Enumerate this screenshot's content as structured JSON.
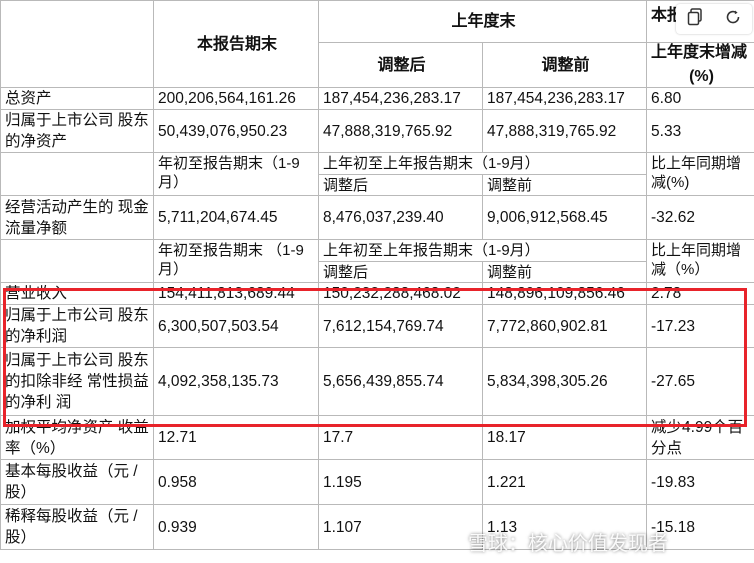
{
  "header": {
    "current_period_end": "本报告期末",
    "last_year_end": "上年度末",
    "adjusted_after": "调整后",
    "adjusted_before": "调整前",
    "change_top_partial": "本报",
    "change_label": "上年度末增减",
    "change_unit": "(%)"
  },
  "rows_top": [
    {
      "label": "总资产",
      "current": "200,206,564,161.26",
      "after": "187,454,236,283.17",
      "before": "187,454,236,283.17",
      "change": "6.80"
    },
    {
      "label": "归属于上市公司 股东的净资产",
      "current": "50,439,076,950.23",
      "after": "47,888,319,765.92",
      "before": "47,888,319,765.92",
      "change": "5.33"
    }
  ],
  "subheader1": {
    "current": "年初至报告期末（1-9 月）",
    "last_year": "上年初至上年报告期末（1-9月）",
    "after": "调整后",
    "before": "调整前",
    "change": "比上年同期增 减(%)"
  },
  "cashflow": {
    "label": "经营活动产生的 现金流量净额",
    "current": "5,711,204,674.45",
    "after": "8,476,037,239.40",
    "before": "9,006,912,568.45",
    "change": "-32.62"
  },
  "subheader2": {
    "current": "年初至报告期末 （1-9 月）",
    "last_year": "上年初至上年报告期末（1-9月）",
    "after": "调整后",
    "before": "调整前",
    "change": "比上年同期增 减（%）"
  },
  "rows_highlight": [
    {
      "label": "营业收入",
      "current": "154,411,813,689.44",
      "after": "150,232,288,468.02",
      "before": "148,896,109,856.46",
      "change": "2.78"
    },
    {
      "label": "归属于上市公司 股东的净利润",
      "current": "6,300,507,503.54",
      "after": "7,612,154,769.74",
      "before": "7,772,860,902.81",
      "change": "-17.23"
    },
    {
      "label": "归属于上市公司 股东的扣除非经 常性损益的净利 润",
      "current": "4,092,358,135.73",
      "after": "5,656,439,855.74",
      "before": "5,834,398,305.26",
      "change": "-27.65"
    }
  ],
  "rows_bottom": [
    {
      "label": "加权平均净资产 收益率（%）",
      "current": "12.71",
      "after": "17.7",
      "before": "18.17",
      "change": "减少4.99个百 分点"
    },
    {
      "label": "基本每股收益（元 / 股）",
      "current": "0.958",
      "after": "1.195",
      "before": "1.221",
      "change": "-19.83"
    },
    {
      "label": "稀释每股收益（元 / 股）",
      "current": "0.939",
      "after": "1.107",
      "before": "1.13",
      "change": "-15.18"
    }
  ],
  "watermark": "雪球：核心价值发现者",
  "toolbar": {
    "copy_icon": "copy-icon",
    "refresh_icon": "refresh-icon"
  }
}
